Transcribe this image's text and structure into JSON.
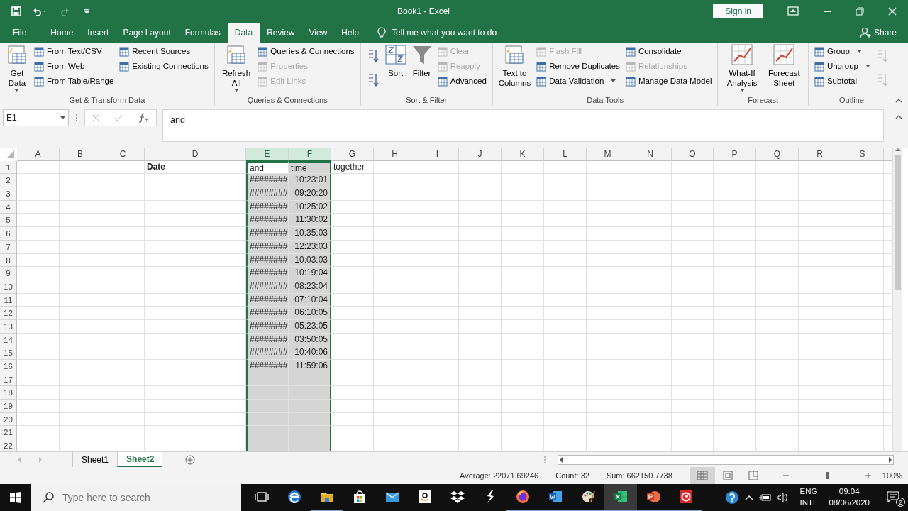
{
  "window": {
    "title": "Book1  -  Excel",
    "sign_in": "Sign in"
  },
  "quick_access": {
    "undo_enabled": true,
    "redo_enabled": false
  },
  "tabs": [
    {
      "label": "File",
      "selected": false
    },
    {
      "label": "Home",
      "selected": false
    },
    {
      "label": "Insert",
      "selected": false
    },
    {
      "label": "Page Layout",
      "selected": false
    },
    {
      "label": "Formulas",
      "selected": false
    },
    {
      "label": "Data",
      "selected": true
    },
    {
      "label": "Review",
      "selected": false
    },
    {
      "label": "View",
      "selected": false
    },
    {
      "label": "Help",
      "selected": false
    }
  ],
  "tell_me": "Tell me what you want to do",
  "share": "Share",
  "ribbon": [
    {
      "label": "Get & Transform Data",
      "columns": [
        [
          {
            "kind": "large",
            "label": "Get Data",
            "dropdown": true,
            "disabled": false
          }
        ],
        [
          {
            "kind": "small",
            "label": "From Text/CSV",
            "dropdown": false,
            "disabled": false
          },
          {
            "kind": "small",
            "label": "From Web",
            "dropdown": false,
            "disabled": false
          },
          {
            "kind": "small",
            "label": "From Table/Range",
            "dropdown": false,
            "disabled": false
          }
        ],
        [
          {
            "kind": "small",
            "label": "Recent Sources",
            "dropdown": false,
            "disabled": false
          },
          {
            "kind": "small",
            "label": "Existing Connections",
            "dropdown": false,
            "disabled": false
          }
        ]
      ]
    },
    {
      "label": "Queries & Connections",
      "columns": [
        [
          {
            "kind": "large",
            "label": "Refresh All",
            "dropdown": true,
            "disabled": false
          }
        ],
        [
          {
            "kind": "small",
            "label": "Queries & Connections",
            "dropdown": false,
            "disabled": false
          },
          {
            "kind": "small",
            "label": "Properties",
            "dropdown": false,
            "disabled": true
          },
          {
            "kind": "small",
            "label": "Edit Links",
            "dropdown": false,
            "disabled": true
          }
        ]
      ]
    },
    {
      "label": "Sort & Filter",
      "columns": [
        [
          {
            "kind": "icon",
            "disabled": false
          },
          {
            "kind": "icon",
            "disabled": false
          }
        ],
        [
          {
            "kind": "large",
            "label": "Sort",
            "dropdown": false,
            "disabled": false
          }
        ],
        [
          {
            "kind": "large",
            "label": "Filter",
            "dropdown": false,
            "disabled": false
          }
        ],
        [
          {
            "kind": "small",
            "label": "Clear",
            "dropdown": false,
            "disabled": true
          },
          {
            "kind": "small",
            "label": "Reapply",
            "dropdown": false,
            "disabled": true
          },
          {
            "kind": "small",
            "label": "Advanced",
            "dropdown": false,
            "disabled": false
          }
        ]
      ]
    },
    {
      "label": "Data Tools",
      "columns": [
        [
          {
            "kind": "large",
            "label": "Text to Columns",
            "dropdown": false,
            "disabled": false
          }
        ],
        [
          {
            "kind": "small",
            "label": "Flash Fill",
            "dropdown": false,
            "disabled": true
          },
          {
            "kind": "small",
            "label": "Remove Duplicates",
            "dropdown": false,
            "disabled": false
          },
          {
            "kind": "small",
            "label": "Data Validation",
            "dropdown": true,
            "disabled": false
          }
        ],
        [
          {
            "kind": "small",
            "label": "Consolidate",
            "dropdown": false,
            "disabled": false
          },
          {
            "kind": "small",
            "label": "Relationships",
            "dropdown": false,
            "disabled": true
          },
          {
            "kind": "small",
            "label": "Manage Data Model",
            "dropdown": false,
            "disabled": false
          }
        ]
      ]
    },
    {
      "label": "Forecast",
      "columns": [
        [
          {
            "kind": "large",
            "label": "What-If Analysis",
            "dropdown": true,
            "disabled": false
          }
        ],
        [
          {
            "kind": "large",
            "label": "Forecast Sheet",
            "dropdown": false,
            "disabled": false
          }
        ]
      ]
    },
    {
      "label": "Outline",
      "columns": [
        [
          {
            "kind": "small",
            "label": "Group",
            "dropdown": true,
            "disabled": false
          },
          {
            "kind": "small",
            "label": "Ungroup",
            "dropdown": true,
            "disabled": false
          },
          {
            "kind": "small",
            "label": "Subtotal",
            "dropdown": false,
            "disabled": false
          }
        ],
        [
          {
            "kind": "icon",
            "disabled": true
          },
          {
            "kind": "icon",
            "disabled": true
          }
        ]
      ]
    }
  ],
  "formula_bar": {
    "name_box": "E1",
    "formula": "and"
  },
  "columns": [
    {
      "letter": "A",
      "selected": false
    },
    {
      "letter": "B",
      "selected": false
    },
    {
      "letter": "C",
      "selected": false
    },
    {
      "letter": "D",
      "selected": false
    },
    {
      "letter": "E",
      "selected": true
    },
    {
      "letter": "F",
      "selected": true
    },
    {
      "letter": "G",
      "selected": false
    },
    {
      "letter": "H",
      "selected": false
    },
    {
      "letter": "I",
      "selected": false
    },
    {
      "letter": "J",
      "selected": false
    },
    {
      "letter": "K",
      "selected": false
    },
    {
      "letter": "L",
      "selected": false
    },
    {
      "letter": "M",
      "selected": false
    },
    {
      "letter": "N",
      "selected": false
    },
    {
      "letter": "O",
      "selected": false
    },
    {
      "letter": "P",
      "selected": false
    },
    {
      "letter": "Q",
      "selected": false
    },
    {
      "letter": "R",
      "selected": false
    },
    {
      "letter": "S",
      "selected": false
    }
  ],
  "rows": [
    {
      "number": "1",
      "cells": [
        {
          "kind": "empty"
        },
        {
          "kind": "empty"
        },
        {
          "kind": "empty"
        },
        {
          "kind": "text",
          "text": "Date",
          "bold": true,
          "active": false
        },
        {
          "kind": "text",
          "text": "and",
          "bold": false,
          "active": true
        },
        {
          "kind": "text",
          "text": "time",
          "bold": false,
          "active": false
        },
        {
          "kind": "text",
          "text": "together",
          "bold": false,
          "active": false
        }
      ]
    },
    {
      "number": "2",
      "cells": [
        {
          "kind": "empty"
        },
        {
          "kind": "empty"
        },
        {
          "kind": "empty"
        },
        {
          "kind": "empty"
        },
        {
          "kind": "text",
          "text": "########",
          "bold": false,
          "active": false
        },
        {
          "kind": "number",
          "text": "10:23:01",
          "bold": false,
          "active": false
        }
      ]
    },
    {
      "number": "3",
      "cells": [
        {
          "kind": "empty"
        },
        {
          "kind": "empty"
        },
        {
          "kind": "empty"
        },
        {
          "kind": "empty"
        },
        {
          "kind": "text",
          "text": "########",
          "bold": false,
          "active": false
        },
        {
          "kind": "number",
          "text": "09:20:20",
          "bold": false,
          "active": false
        }
      ]
    },
    {
      "number": "4",
      "cells": [
        {
          "kind": "empty"
        },
        {
          "kind": "empty"
        },
        {
          "kind": "empty"
        },
        {
          "kind": "empty"
        },
        {
          "kind": "text",
          "text": "########",
          "bold": false,
          "active": false
        },
        {
          "kind": "number",
          "text": "10:25:02",
          "bold": false,
          "active": false
        }
      ]
    },
    {
      "number": "5",
      "cells": [
        {
          "kind": "empty"
        },
        {
          "kind": "empty"
        },
        {
          "kind": "empty"
        },
        {
          "kind": "empty"
        },
        {
          "kind": "text",
          "text": "########",
          "bold": false,
          "active": false
        },
        {
          "kind": "number",
          "text": "11:30:02",
          "bold": false,
          "active": false
        }
      ]
    },
    {
      "number": "6",
      "cells": [
        {
          "kind": "empty"
        },
        {
          "kind": "empty"
        },
        {
          "kind": "empty"
        },
        {
          "kind": "empty"
        },
        {
          "kind": "text",
          "text": "########",
          "bold": false,
          "active": false
        },
        {
          "kind": "number",
          "text": "10:35:03",
          "bold": false,
          "active": false
        }
      ]
    },
    {
      "number": "7",
      "cells": [
        {
          "kind": "empty"
        },
        {
          "kind": "empty"
        },
        {
          "kind": "empty"
        },
        {
          "kind": "empty"
        },
        {
          "kind": "text",
          "text": "########",
          "bold": false,
          "active": false
        },
        {
          "kind": "number",
          "text": "12:23:03",
          "bold": false,
          "active": false
        }
      ]
    },
    {
      "number": "8",
      "cells": [
        {
          "kind": "empty"
        },
        {
          "kind": "empty"
        },
        {
          "kind": "empty"
        },
        {
          "kind": "empty"
        },
        {
          "kind": "text",
          "text": "########",
          "bold": false,
          "active": false
        },
        {
          "kind": "number",
          "text": "10:03:03",
          "bold": false,
          "active": false
        }
      ]
    },
    {
      "number": "9",
      "cells": [
        {
          "kind": "empty"
        },
        {
          "kind": "empty"
        },
        {
          "kind": "empty"
        },
        {
          "kind": "empty"
        },
        {
          "kind": "text",
          "text": "########",
          "bold": false,
          "active": false
        },
        {
          "kind": "number",
          "text": "10:19:04",
          "bold": false,
          "active": false
        }
      ]
    },
    {
      "number": "10",
      "cells": [
        {
          "kind": "empty"
        },
        {
          "kind": "empty"
        },
        {
          "kind": "empty"
        },
        {
          "kind": "empty"
        },
        {
          "kind": "text",
          "text": "########",
          "bold": false,
          "active": false
        },
        {
          "kind": "number",
          "text": "08:23:04",
          "bold": false,
          "active": false
        }
      ]
    },
    {
      "number": "11",
      "cells": [
        {
          "kind": "empty"
        },
        {
          "kind": "empty"
        },
        {
          "kind": "empty"
        },
        {
          "kind": "empty"
        },
        {
          "kind": "text",
          "text": "########",
          "bold": false,
          "active": false
        },
        {
          "kind": "number",
          "text": "07:10:04",
          "bold": false,
          "active": false
        }
      ]
    },
    {
      "number": "12",
      "cells": [
        {
          "kind": "empty"
        },
        {
          "kind": "empty"
        },
        {
          "kind": "empty"
        },
        {
          "kind": "empty"
        },
        {
          "kind": "text",
          "text": "########",
          "bold": false,
          "active": false
        },
        {
          "kind": "number",
          "text": "06:10:05",
          "bold": false,
          "active": false
        }
      ]
    },
    {
      "number": "13",
      "cells": [
        {
          "kind": "empty"
        },
        {
          "kind": "empty"
        },
        {
          "kind": "empty"
        },
        {
          "kind": "empty"
        },
        {
          "kind": "text",
          "text": "########",
          "bold": false,
          "active": false
        },
        {
          "kind": "number",
          "text": "05:23:05",
          "bold": false,
          "active": false
        }
      ]
    },
    {
      "number": "14",
      "cells": [
        {
          "kind": "empty"
        },
        {
          "kind": "empty"
        },
        {
          "kind": "empty"
        },
        {
          "kind": "empty"
        },
        {
          "kind": "text",
          "text": "########",
          "bold": false,
          "active": false
        },
        {
          "kind": "number",
          "text": "03:50:05",
          "bold": false,
          "active": false
        }
      ]
    },
    {
      "number": "15",
      "cells": [
        {
          "kind": "empty"
        },
        {
          "kind": "empty"
        },
        {
          "kind": "empty"
        },
        {
          "kind": "empty"
        },
        {
          "kind": "text",
          "text": "########",
          "bold": false,
          "active": false
        },
        {
          "kind": "number",
          "text": "10:40:06",
          "bold": false,
          "active": false
        }
      ]
    },
    {
      "number": "16",
      "cells": [
        {
          "kind": "empty"
        },
        {
          "kind": "empty"
        },
        {
          "kind": "empty"
        },
        {
          "kind": "empty"
        },
        {
          "kind": "text",
          "text": "########",
          "bold": false,
          "active": false
        },
        {
          "kind": "number",
          "text": "11:59:06",
          "bold": false,
          "active": false
        }
      ]
    },
    {
      "number": "17",
      "cells": []
    },
    {
      "number": "18",
      "cells": []
    },
    {
      "number": "19",
      "cells": []
    },
    {
      "number": "20",
      "cells": []
    },
    {
      "number": "21",
      "cells": []
    },
    {
      "number": "22",
      "cells": []
    }
  ],
  "sheets": [
    {
      "label": "Sheet1",
      "selected": false
    },
    {
      "label": "Sheet2",
      "selected": true
    }
  ],
  "status_bar": {
    "average": "Average: 22071.69246",
    "count": "Count: 32",
    "sum": "Sum: 662150.7738",
    "views": [
      {
        "selected": true
      },
      {
        "selected": false
      },
      {
        "selected": false
      }
    ],
    "zoom": {
      "level": 0.5,
      "reading": "100%"
    }
  },
  "taskbar": {
    "search_placeholder": "Type here to search",
    "apps": [
      {
        "running": false,
        "active": false
      },
      {
        "running": false,
        "active": false
      },
      {
        "running": true,
        "active": false
      },
      {
        "running": false,
        "active": false
      },
      {
        "running": false,
        "active": false
      },
      {
        "running": false,
        "active": false
      },
      {
        "running": false,
        "active": false
      },
      {
        "running": false,
        "active": false
      },
      {
        "running": true,
        "active": false
      },
      {
        "running": true,
        "active": false
      },
      {
        "running": true,
        "active": false
      },
      {
        "running": true,
        "active": true
      },
      {
        "running": true,
        "active": false
      },
      {
        "running": true,
        "active": false
      }
    ],
    "language": "ENG",
    "layout": "INTL",
    "time": "09:04",
    "date": "08/06/2020",
    "notifications": "2"
  }
}
